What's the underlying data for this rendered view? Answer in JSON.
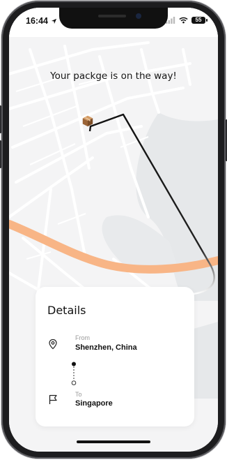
{
  "status_bar": {
    "time": "16:44",
    "battery": "55"
  },
  "map": {
    "headline": "Your packge is on the way!",
    "icons": {
      "package": "package-box-icon",
      "location_arrow": "location-arrow-icon"
    },
    "colors": {
      "road": "#ffffff",
      "land": "#f4f4f5",
      "water": "#e6e8ea",
      "highway": "#f8b586",
      "route": "#111111"
    }
  },
  "details": {
    "title": "Details",
    "from": {
      "label": "From",
      "value": "Shenzhen, China",
      "icon": "map-pin-icon"
    },
    "to": {
      "label": "To",
      "value": "Singapore",
      "icon": "flag-icon"
    }
  }
}
